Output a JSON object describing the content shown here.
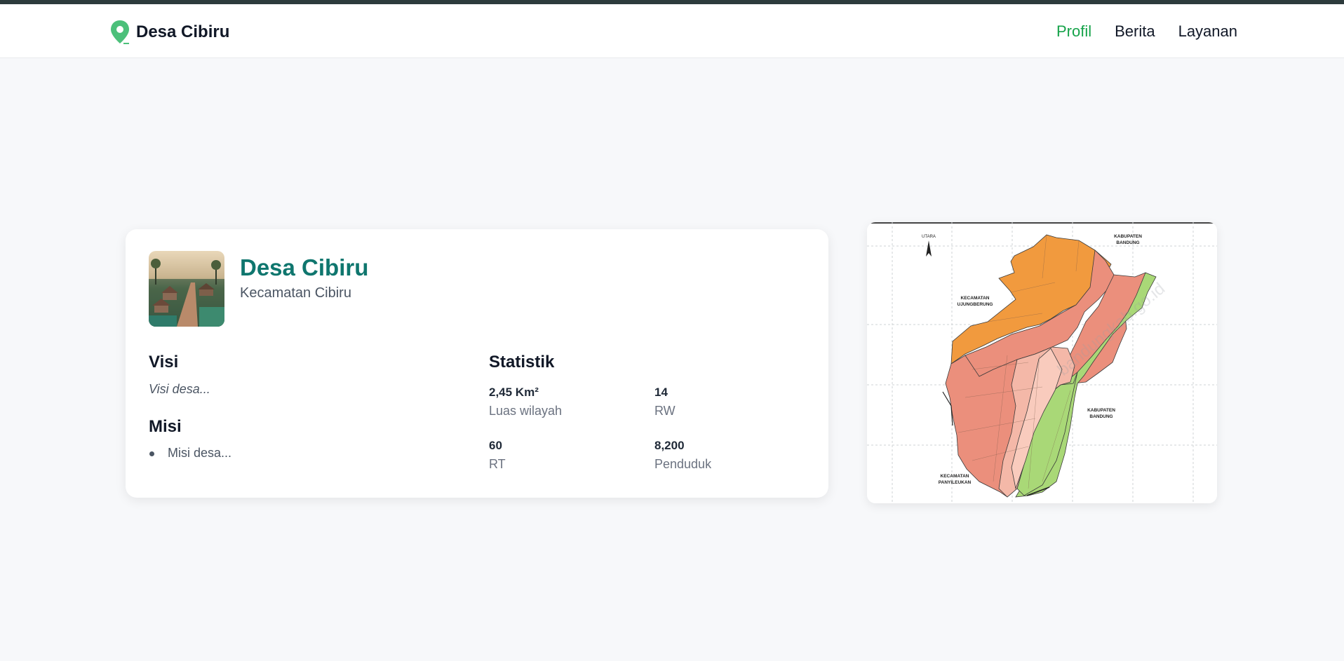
{
  "header": {
    "brand": "Desa Cibiru",
    "brand_icon": "map-pin-icon",
    "nav": [
      {
        "label": "Profil",
        "active": true
      },
      {
        "label": "Berita",
        "active": false
      },
      {
        "label": "Layanan",
        "active": false
      }
    ]
  },
  "profile": {
    "name": "Desa Cibiru",
    "district": "Kecamatan Cibiru",
    "visi_heading": "Visi",
    "visi_text": "Visi desa...",
    "misi_heading": "Misi",
    "misi_items": [
      "Misi desa..."
    ],
    "stats_heading": "Statistik",
    "stats": [
      {
        "value": "2,45 Km²",
        "label": "Luas wilayah"
      },
      {
        "value": "14",
        "label": "RW"
      },
      {
        "value": "60",
        "label": "RT"
      },
      {
        "value": "8,200",
        "label": "Penduduk"
      }
    ]
  },
  "map": {
    "north_label": "UTARA",
    "labels": {
      "top_right": [
        "KABUPATEN",
        "BANDUNG"
      ],
      "left": [
        "KECAMATAN",
        "UJUNGBERUNG"
      ],
      "right": [
        "KABUPATEN",
        "BANDUNG"
      ],
      "bottom_left": [
        "KECAMATAN",
        "PANYILEUKAN"
      ]
    },
    "colors": {
      "orange": "#f19a3e",
      "salmon": "#eb8f7c",
      "pink": "#f4b8a8",
      "green": "#a9d877",
      "accent": "#16a34a",
      "title": "#0f766e"
    }
  }
}
